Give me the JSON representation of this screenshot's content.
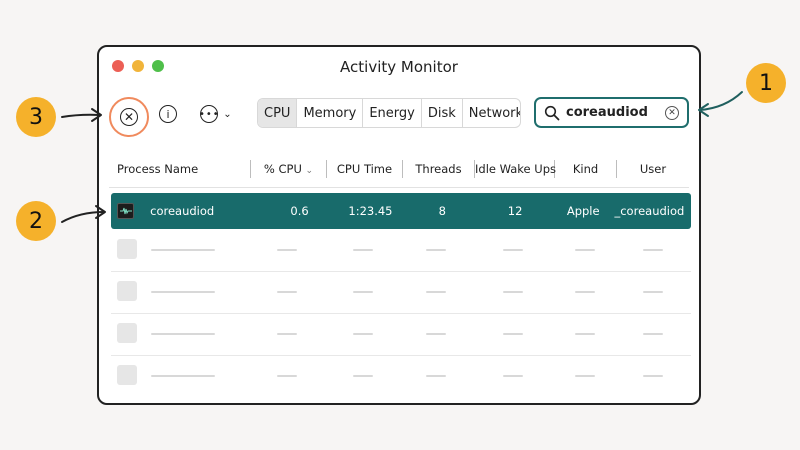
{
  "window": {
    "title": "Activity Monitor"
  },
  "toolbar": {
    "stop_icon": "x-circle-icon",
    "info_icon": "info-icon",
    "more_icon": "ellipsis-circle-icon",
    "tabs": [
      {
        "label": "CPU",
        "active": true
      },
      {
        "label": "Memory",
        "active": false
      },
      {
        "label": "Energy",
        "active": false
      },
      {
        "label": "Disk",
        "active": false
      },
      {
        "label": "Network",
        "active": false
      }
    ]
  },
  "search": {
    "value": "coreaudiod"
  },
  "table": {
    "columns": [
      "Process Name",
      "% CPU",
      "CPU Time",
      "Threads",
      "Idle Wake Ups",
      "Kind",
      "User"
    ],
    "sort_column": "% CPU",
    "selected_row": {
      "name": "coreaudiod",
      "cpu": "0.6",
      "cpu_time": "1:23.45",
      "threads": "8",
      "idle_wake_ups": "12",
      "kind": "Apple",
      "user": "_coreaudiod"
    },
    "placeholder_rows": 4
  },
  "callouts": [
    "1",
    "2",
    "3"
  ],
  "colors": {
    "selection": "#186b6b",
    "search_border": "#1f6e6d",
    "callout": "#f5b12b",
    "stop_highlight": "#f08a5d"
  }
}
